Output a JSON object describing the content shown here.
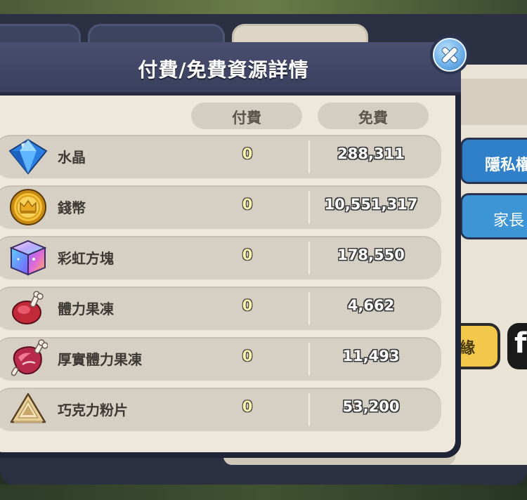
{
  "background": {
    "tabs": [
      "",
      "",
      ""
    ],
    "side_field": "",
    "side_buttons": [
      "隱私權",
      "家長"
    ],
    "side_yellow": "緣",
    "side_social": "f"
  },
  "modal": {
    "title": "付費/免費資源詳情",
    "close_label": "×"
  },
  "columns": {
    "paid": "付費",
    "free": "免費"
  },
  "resources": [
    {
      "name": "水晶",
      "icon": "crystal-icon",
      "paid": "0",
      "free": "288,311"
    },
    {
      "name": "錢幣",
      "icon": "coin-icon",
      "paid": "0",
      "free": "10,551,317"
    },
    {
      "name": "彩虹方塊",
      "icon": "rainbow-cube-icon",
      "paid": "0",
      "free": "178,550"
    },
    {
      "name": "體力果凍",
      "icon": "stamina-jelly-icon",
      "paid": "0",
      "free": "4,662"
    },
    {
      "name": "厚實體力果凍",
      "icon": "thick-stamina-jelly-icon",
      "paid": "0",
      "free": "11,493"
    },
    {
      "name": "巧克力粉片",
      "icon": "chocolate-flake-icon",
      "paid": "0",
      "free": "53,200"
    }
  ],
  "colors": {
    "header": "#3a3f5e",
    "body": "#ede7dc",
    "row": "#d6cfc4",
    "close_button": "#6fb2ea"
  }
}
